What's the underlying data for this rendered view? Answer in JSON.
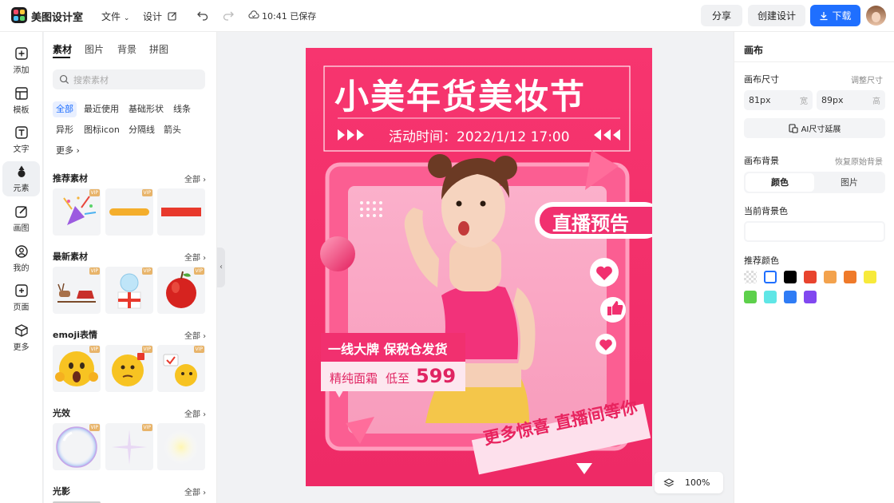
{
  "app": {
    "name": "美图设计室"
  },
  "topbar": {
    "file_menu": "文件",
    "design_menu": "设计",
    "save_status": "10:41 已保存",
    "share_label": "分享",
    "create_label": "创建设计",
    "download_label": "下载"
  },
  "left_rail": [
    {
      "label": "添加",
      "icon": "add-icon"
    },
    {
      "label": "模板",
      "icon": "template-icon"
    },
    {
      "label": "文字",
      "icon": "text-icon"
    },
    {
      "label": "元素",
      "icon": "shapes-icon",
      "active": true
    },
    {
      "label": "画图",
      "icon": "draw-icon"
    },
    {
      "label": "我的",
      "icon": "user-icon"
    },
    {
      "label": "页面",
      "icon": "page-icon"
    },
    {
      "label": "更多",
      "icon": "cube-icon"
    }
  ],
  "panel": {
    "tabs": [
      "素材",
      "图片",
      "背景",
      "拼图"
    ],
    "search_placeholder": "搜索素材",
    "chips": [
      "全部",
      "最近使用",
      "基础形状",
      "线条",
      "异形",
      "图标icon",
      "分隔线",
      "箭头",
      "更多"
    ],
    "view_all": "全部",
    "vip": "VIP",
    "sections": [
      {
        "title": "推荐素材"
      },
      {
        "title": "最新素材"
      },
      {
        "title": "emoji表情"
      },
      {
        "title": "光效"
      },
      {
        "title": "光影"
      }
    ]
  },
  "poster": {
    "title": "小美年货美妆节",
    "time": "活动时间：2022/1/12 17:00",
    "live": "直播预告",
    "promo1": "一线大牌 保税仓发货",
    "promo2_prefix": "精纯面霜",
    "promo2_mid": "低至",
    "price": "599",
    "footer": "更多惊喜 直播间等你"
  },
  "zoom": {
    "level": "100%"
  },
  "right_panel": {
    "title": "画布",
    "size_label": "画布尺寸",
    "resize_link": "调整尺寸",
    "width_value": "81px",
    "width_unit": "宽",
    "height_value": "89px",
    "height_unit": "高",
    "ai_extend": "AI尺寸延展",
    "bg_label": "画布背景",
    "restore_link": "恢复原始背景",
    "bg_tabs": [
      "颜色",
      "图片"
    ],
    "current_bg_label": "当前背景色",
    "recommend_label": "推荐颜色",
    "colors": [
      "transparent",
      "#ffffff",
      "#000000",
      "#e8442e",
      "#f3a24d",
      "#ef7a2a",
      "#f7ea3b",
      "#5dd04b",
      "#5fe6e6",
      "#2f7cf5",
      "#8148f0"
    ]
  }
}
